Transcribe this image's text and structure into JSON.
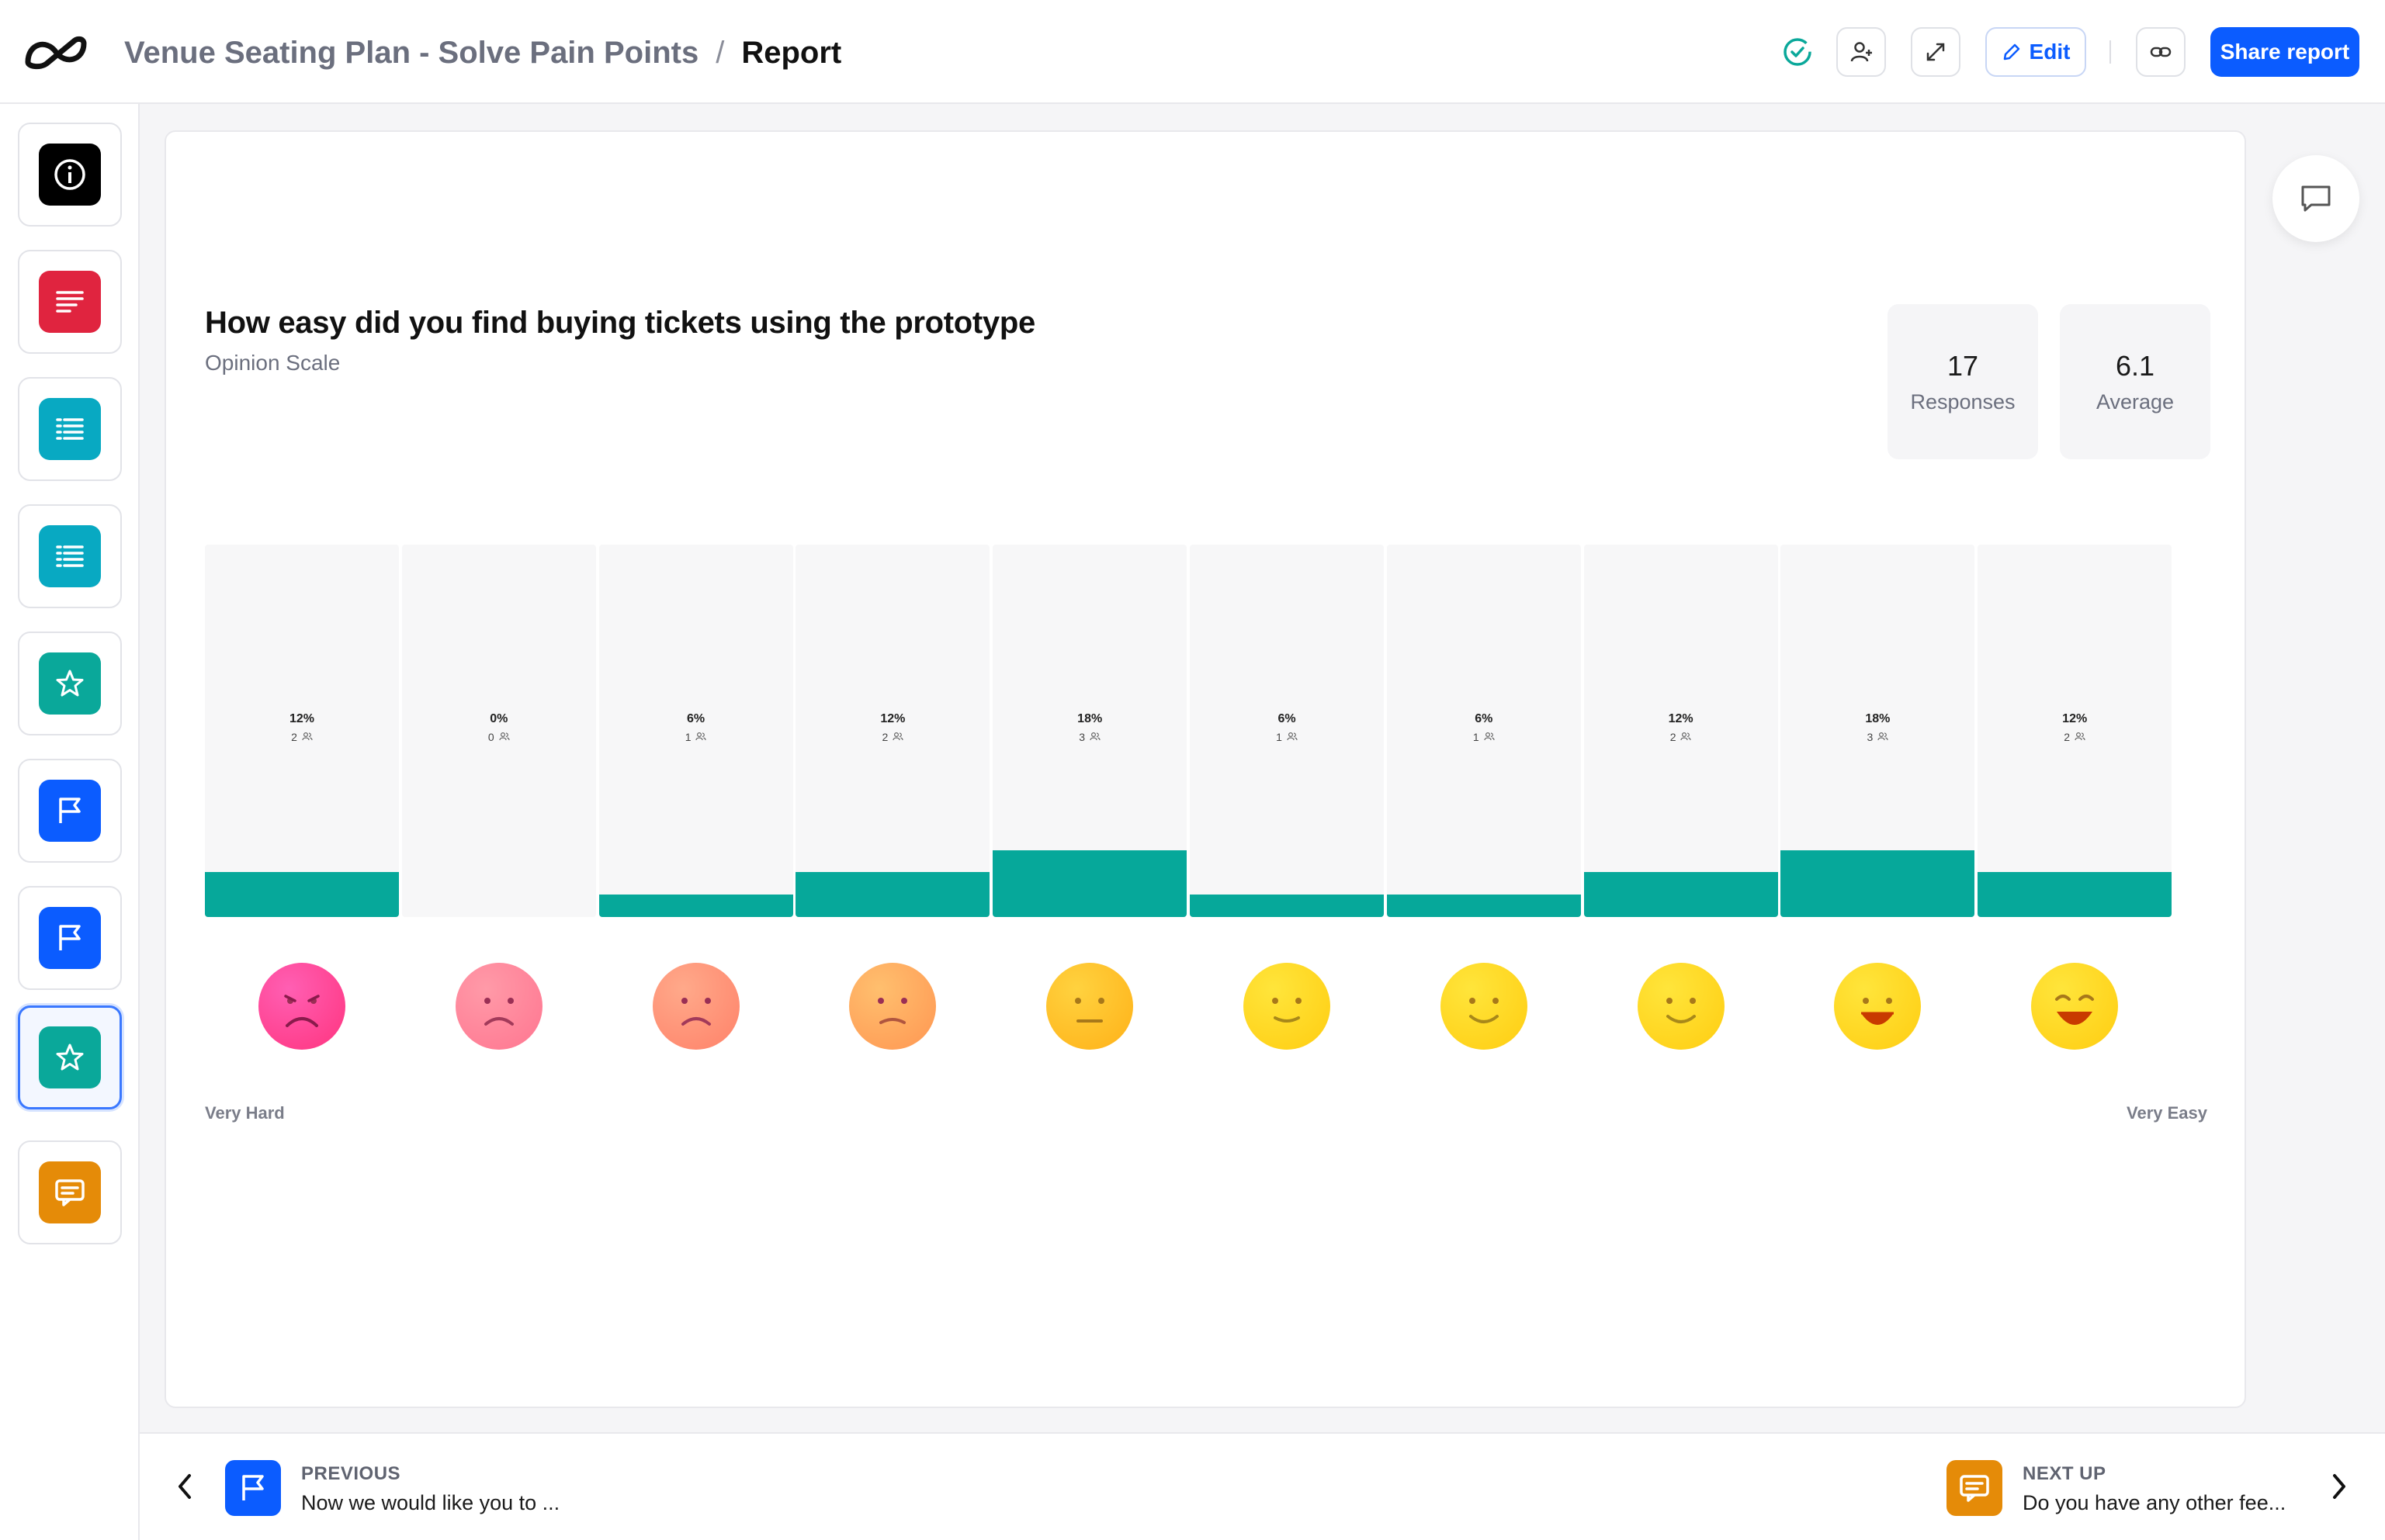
{
  "header": {
    "project_name": "Venue Seating Plan - Solve Pain Points",
    "separator": "/",
    "page_name": "Report",
    "edit_label": "Edit",
    "share_label": "Share report"
  },
  "sidebar": {
    "items": [
      {
        "icon": "info-icon",
        "color": "#000000"
      },
      {
        "icon": "text-lines-icon",
        "color": "#e0243f"
      },
      {
        "icon": "list-icon",
        "color": "#08a9c2"
      },
      {
        "icon": "list-icon",
        "color": "#08a9c2"
      },
      {
        "icon": "star-icon",
        "color": "#0aa89a"
      },
      {
        "icon": "flag-icon",
        "color": "#0b5cff"
      },
      {
        "icon": "flag-icon",
        "color": "#0b5cff"
      },
      {
        "icon": "star-icon",
        "color": "#0aa89a",
        "active": true
      },
      {
        "icon": "chat-icon",
        "color": "#e58b08"
      }
    ]
  },
  "question": {
    "title": "How easy did you find buying tickets using the prototype",
    "type": "Opinion Scale"
  },
  "stats": {
    "responses_value": "17",
    "responses_label": "Responses",
    "average_value": "6.1",
    "average_label": "Average"
  },
  "chart_data": {
    "type": "bar",
    "categories": [
      "1",
      "2",
      "3",
      "4",
      "5",
      "6",
      "7",
      "8",
      "9",
      "10"
    ],
    "values": [
      12,
      0,
      6,
      12,
      18,
      6,
      6,
      12,
      18,
      12
    ],
    "value_labels": [
      "12%",
      "0%",
      "6%",
      "12%",
      "18%",
      "6%",
      "6%",
      "12%",
      "18%",
      "12%"
    ],
    "counts": [
      "2",
      "0",
      "1",
      "2",
      "3",
      "1",
      "1",
      "2",
      "3",
      "2"
    ],
    "ylim": [
      0,
      100
    ],
    "bar_color": "#06a89a",
    "scale_min_label": "Very Hard",
    "scale_max_label": "Very Easy"
  },
  "faces": [
    {
      "color_a": "#ff5fb3",
      "color_b": "#ff3d8a",
      "mood": "very-sad"
    },
    {
      "color_a": "#ff9aa8",
      "color_b": "#ff7d95",
      "mood": "sad"
    },
    {
      "color_a": "#ffa98a",
      "color_b": "#ff8a70",
      "mood": "sad"
    },
    {
      "color_a": "#ffbf6e",
      "color_b": "#ff9f58",
      "mood": "slightly-sad"
    },
    {
      "color_a": "#ffd23f",
      "color_b": "#ffb820",
      "mood": "neutral"
    },
    {
      "color_a": "#ffe53b",
      "color_b": "#ffd21a",
      "mood": "slight-smile"
    },
    {
      "color_a": "#ffe53b",
      "color_b": "#ffd21a",
      "mood": "smile"
    },
    {
      "color_a": "#ffe53b",
      "color_b": "#ffd21a",
      "mood": "smile"
    },
    {
      "color_a": "#ffe53b",
      "color_b": "#ffd21a",
      "mood": "happy"
    },
    {
      "color_a": "#ffe53b",
      "color_b": "#ffd21a",
      "mood": "very-happy"
    }
  ],
  "footer": {
    "previous_label": "PREVIOUS",
    "previous_text": "Now we would like you to ...",
    "next_label": "NEXT UP",
    "next_text": "Do you have any other fee..."
  },
  "colors": {
    "brand_blue": "#0b5cff",
    "status_green": "#0aa89a"
  }
}
